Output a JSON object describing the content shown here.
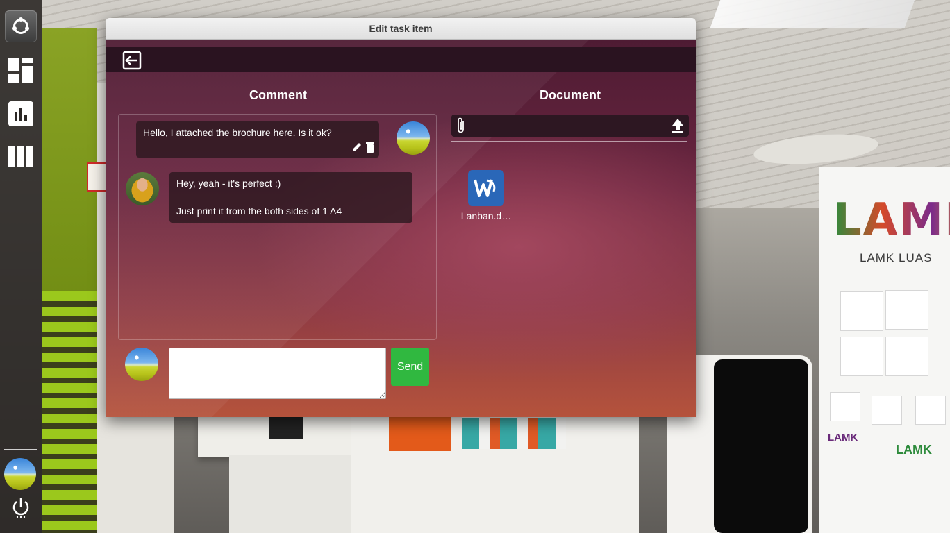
{
  "window": {
    "title": "Edit task item"
  },
  "sections": {
    "comment_title": "Comment",
    "document_title": "Document"
  },
  "comments": [
    {
      "text": "Hello, I attached the brochure here. Is it ok?",
      "own": true
    },
    {
      "lines": [
        "Hey, yeah - it's perfect :)",
        "Just print it from the both sides of 1 A4"
      ],
      "own": false
    }
  ],
  "composer": {
    "value": "",
    "send_label": "Send"
  },
  "documents": [
    {
      "name": "Lanban.d…",
      "icon": "word-document-icon"
    }
  ],
  "launcher": {
    "items": [
      "ubuntu-logo-icon",
      "dashboard-icon",
      "bar-chart-icon",
      "columns-icon"
    ],
    "bottom": [
      "user-avatar",
      "power-icon"
    ]
  },
  "background": {
    "banner_logo": "LAMK",
    "banner_sub": "LAMK LUAS",
    "banner_caption_1": "LAMK",
    "banner_caption_2": "LAMK"
  },
  "colors": {
    "send": "#30b840",
    "toolbar": "#2a1320",
    "file_icon": "#2a67b8"
  }
}
